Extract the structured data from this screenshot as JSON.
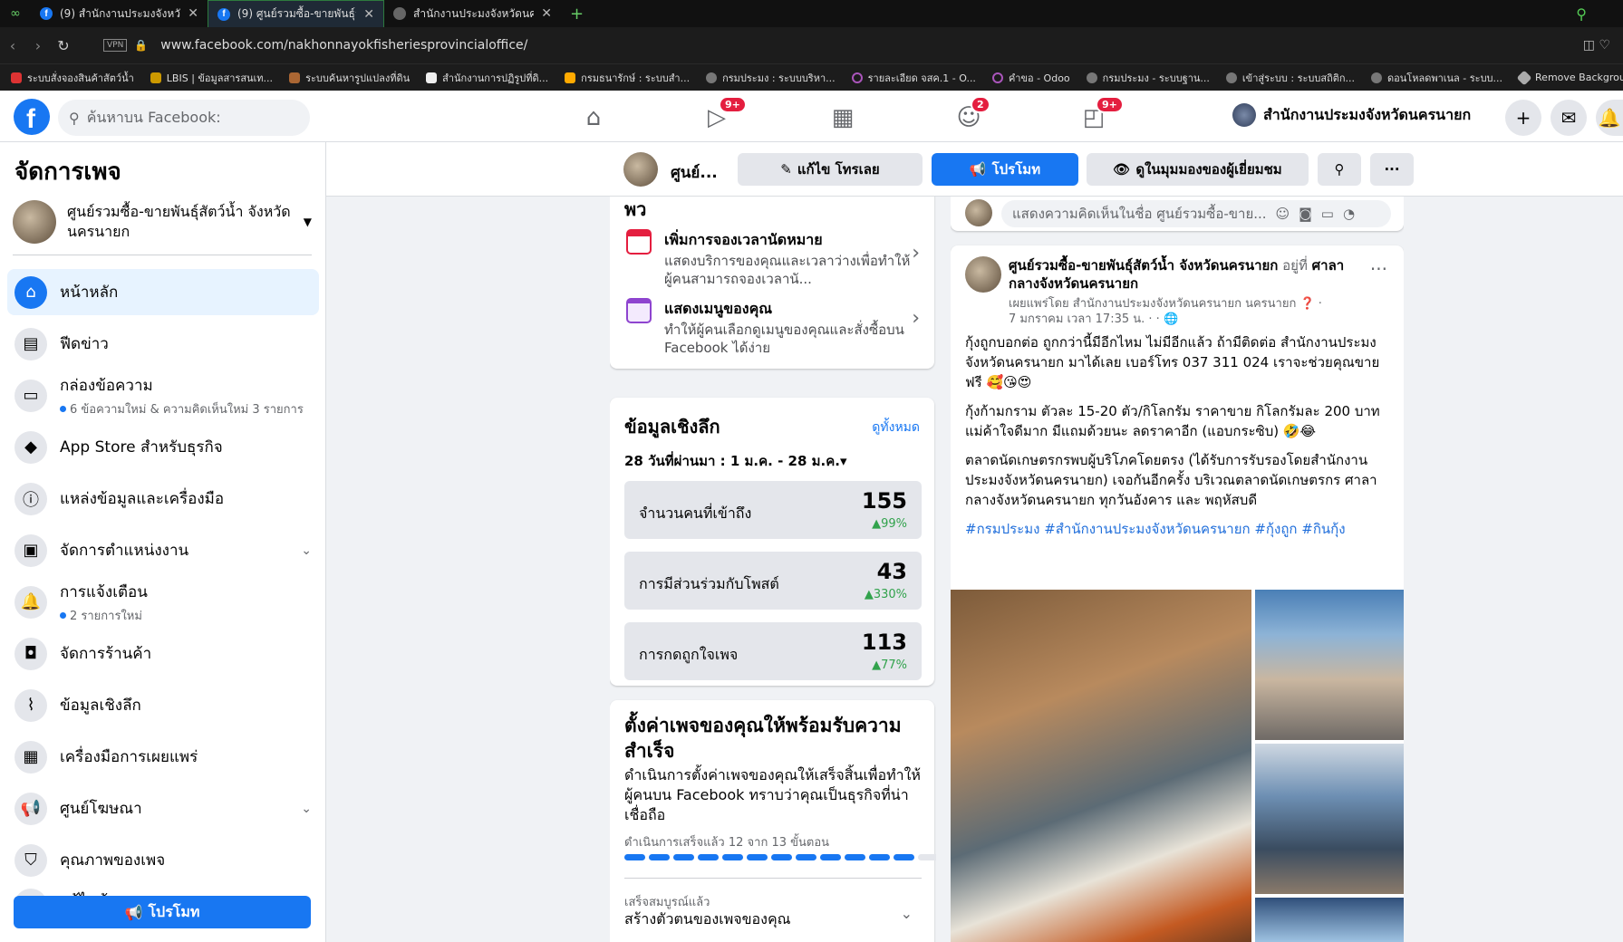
{
  "browser": {
    "tabs": [
      {
        "title": "(9) สำนักงานประมงจังหวัดนครน"
      },
      {
        "title": "(9) ศูนย์รวมซื้อ-ขายพันธุ์สัตว์น้ำ"
      },
      {
        "title": "สำนักงานประมงจังหวัดนครนาย"
      }
    ],
    "vpn": "VPN",
    "url": "www.facebook.com/nakhonnayokfisheriesprovincialoffice/",
    "bookmarks": [
      "ระบบสั่งจองสินค้าสัตว์น้ำ",
      "LBIS | ข้อมูลสารสนเท...",
      "ระบบค้นหารูปแปลงที่ดิน",
      "สำนักงานการปฏิรูปที่ดิ...",
      "กรมธนารักษ์ : ระบบสำ...",
      "กรมประมง : ระบบบริหา...",
      "รายละเอียด จสค.1 - O...",
      "คำขอ - Odoo",
      "กรมประมง - ระบบฐาน...",
      "เข้าสู่ระบบ : ระบบสถิติก...",
      "ดอนโหลดพาเนล - ระบบ...",
      "Remove Backgroun..."
    ]
  },
  "fbnav": {
    "search_placeholder": "ค้นหาบน Facebook:",
    "badges": {
      "watch": "9+",
      "groups": "2",
      "gaming": "9+"
    },
    "page_name": "สำนักงานประมงจังหวัดนครนายก"
  },
  "sidebar": {
    "title": "จัดการเพจ",
    "page_name": "ศูนย์รวมซื้อ-ขายพันธุ์สัตว์น้ำ จังหวัดนครนายก",
    "items": [
      {
        "label": "หน้าหลัก"
      },
      {
        "label": "ฟีดข่าว"
      },
      {
        "label": "กล่องข้อความ",
        "sub": "6 ข้อความใหม่ & ความคิดเห็นใหม่ 3 รายการ"
      },
      {
        "label": "App Store สำหรับธุรกิจ"
      },
      {
        "label": "แหล่งข้อมูลและเครื่องมือ"
      },
      {
        "label": "จัดการตำแหน่งงาน"
      },
      {
        "label": "การแจ้งเตือน",
        "sub": "2 รายการใหม่"
      },
      {
        "label": "จัดการร้านค้า"
      },
      {
        "label": "ข้อมูลเชิงลึก"
      },
      {
        "label": "เครื่องมือการเผยแพร่"
      },
      {
        "label": "ศูนย์โฆษณา"
      },
      {
        "label": "คุณภาพของเพจ"
      },
      {
        "label": "แก้ไขข้อมูลเพจ"
      }
    ],
    "promote": "โปรโมท"
  },
  "actionbar": {
    "name": "ศูนย์...",
    "edit": "แก้ไข โทรเลย",
    "promote": "โปรโมท",
    "view_as": "ดูในมุมมองของผู้เยี่ยมชม"
  },
  "mid": {
    "top_heading": "พว",
    "rows": [
      {
        "title": "เพิ่มการจองเวลานัดหมาย",
        "desc": "แสดงบริการของคุณและเวลาว่างเพื่อทำให้ผู้คนสามารถจองเวลานั..."
      },
      {
        "title": "แสดงเมนูของคุณ",
        "desc": "ทำให้ผู้คนเลือกดูเมนูของคุณและสั่งซื้อบน Facebook ได้ง่าย"
      }
    ],
    "insights": {
      "title": "ข้อมูลเชิงลึก",
      "see_all": "ดูทั้งหมด",
      "range": "28 วันที่ผ่านมา : 1 ม.ค. - 28 ม.ค.▾",
      "stats": [
        {
          "label": "จำนวนคนที่เข้าถึง",
          "value": "155",
          "pct": "▲99%"
        },
        {
          "label": "การมีส่วนร่วมกับโพสต์",
          "value": "43",
          "pct": "▲330%"
        },
        {
          "label": "การกดถูกใจเพจ",
          "value": "113",
          "pct": "▲77%"
        }
      ]
    },
    "setup": {
      "title": "ตั้งค่าเพจของคุณให้พร้อมรับความสำเร็จ",
      "desc": "ดำเนินการตั้งค่าเพจของคุณให้เสร็จสิ้นเพื่อทำให้ผู้คนบน Facebook ทราบว่าคุณเป็นธุรกิจที่น่าเชื่อถือ",
      "progress_text": "ดำเนินการเสร็จแล้ว 12 จาก 13 ขั้นตอน",
      "steps_done": 12,
      "steps_total": 13,
      "done_label": "เสร็จสมบูรณ์แล้ว",
      "task": "สร้างตัวตนของเพจของคุณ"
    }
  },
  "post": {
    "comment_placeholder": "แสดงความคิดเห็นในชื่อ ศูนย์รวมซื้อ-ขาย...",
    "author": "ศูนย์รวมซื้อ-ขายพันธุ์สัตว์น้ำ จังหวัดนครนายก",
    "at": "อยู่ที่",
    "place": "ศาลากลางจังหวัดนครนายก",
    "meta1": "เผยแพร่โดย สำนักงานประมงจังหวัดนครนายก นครนายก",
    "meta2": "7 มกราคม เวลา 17:35 น. · ·",
    "p1": "กุ้งถูกบอกต่อ ถูกกว่านี้มีอีกไหม ไม่มีอีกแล้ว ถ้ามีติดต่อ สำนักงานประมงจังหวัดนครนายก มาได้เลย เบอร์โทร 037 311 024 เราจะช่วยคุณขาย ฟรี 🥰😘😍",
    "p2": "กุ้งก้ามกราม ตัวละ 15-20 ตัว/กิโลกรัม ราคาขาย กิโลกรัมละ 200 บาท แม่ค้าใจดีมาก มีแถมด้วยนะ ลดราคาอีก (แอบกระซิบ) 🤣😂",
    "p3": "ตลาดนัดเกษตรกรพบผู้บริโภคโดยตรง (ได้รับการรับรองโดยสำนักงานประมงจังหวัดนครนายก) เจอกันอีกครั้ง บริเวณตลาดนัดเกษตรกร ศาลากลางจังหวัดนครนายก ทุกวันอังคาร และ พฤหัสบดี",
    "hashtags": "#กรมประมง #สำนักงานประมงจังหวัดนครนายก #กุ้งถูก #กินกุ้ง"
  }
}
